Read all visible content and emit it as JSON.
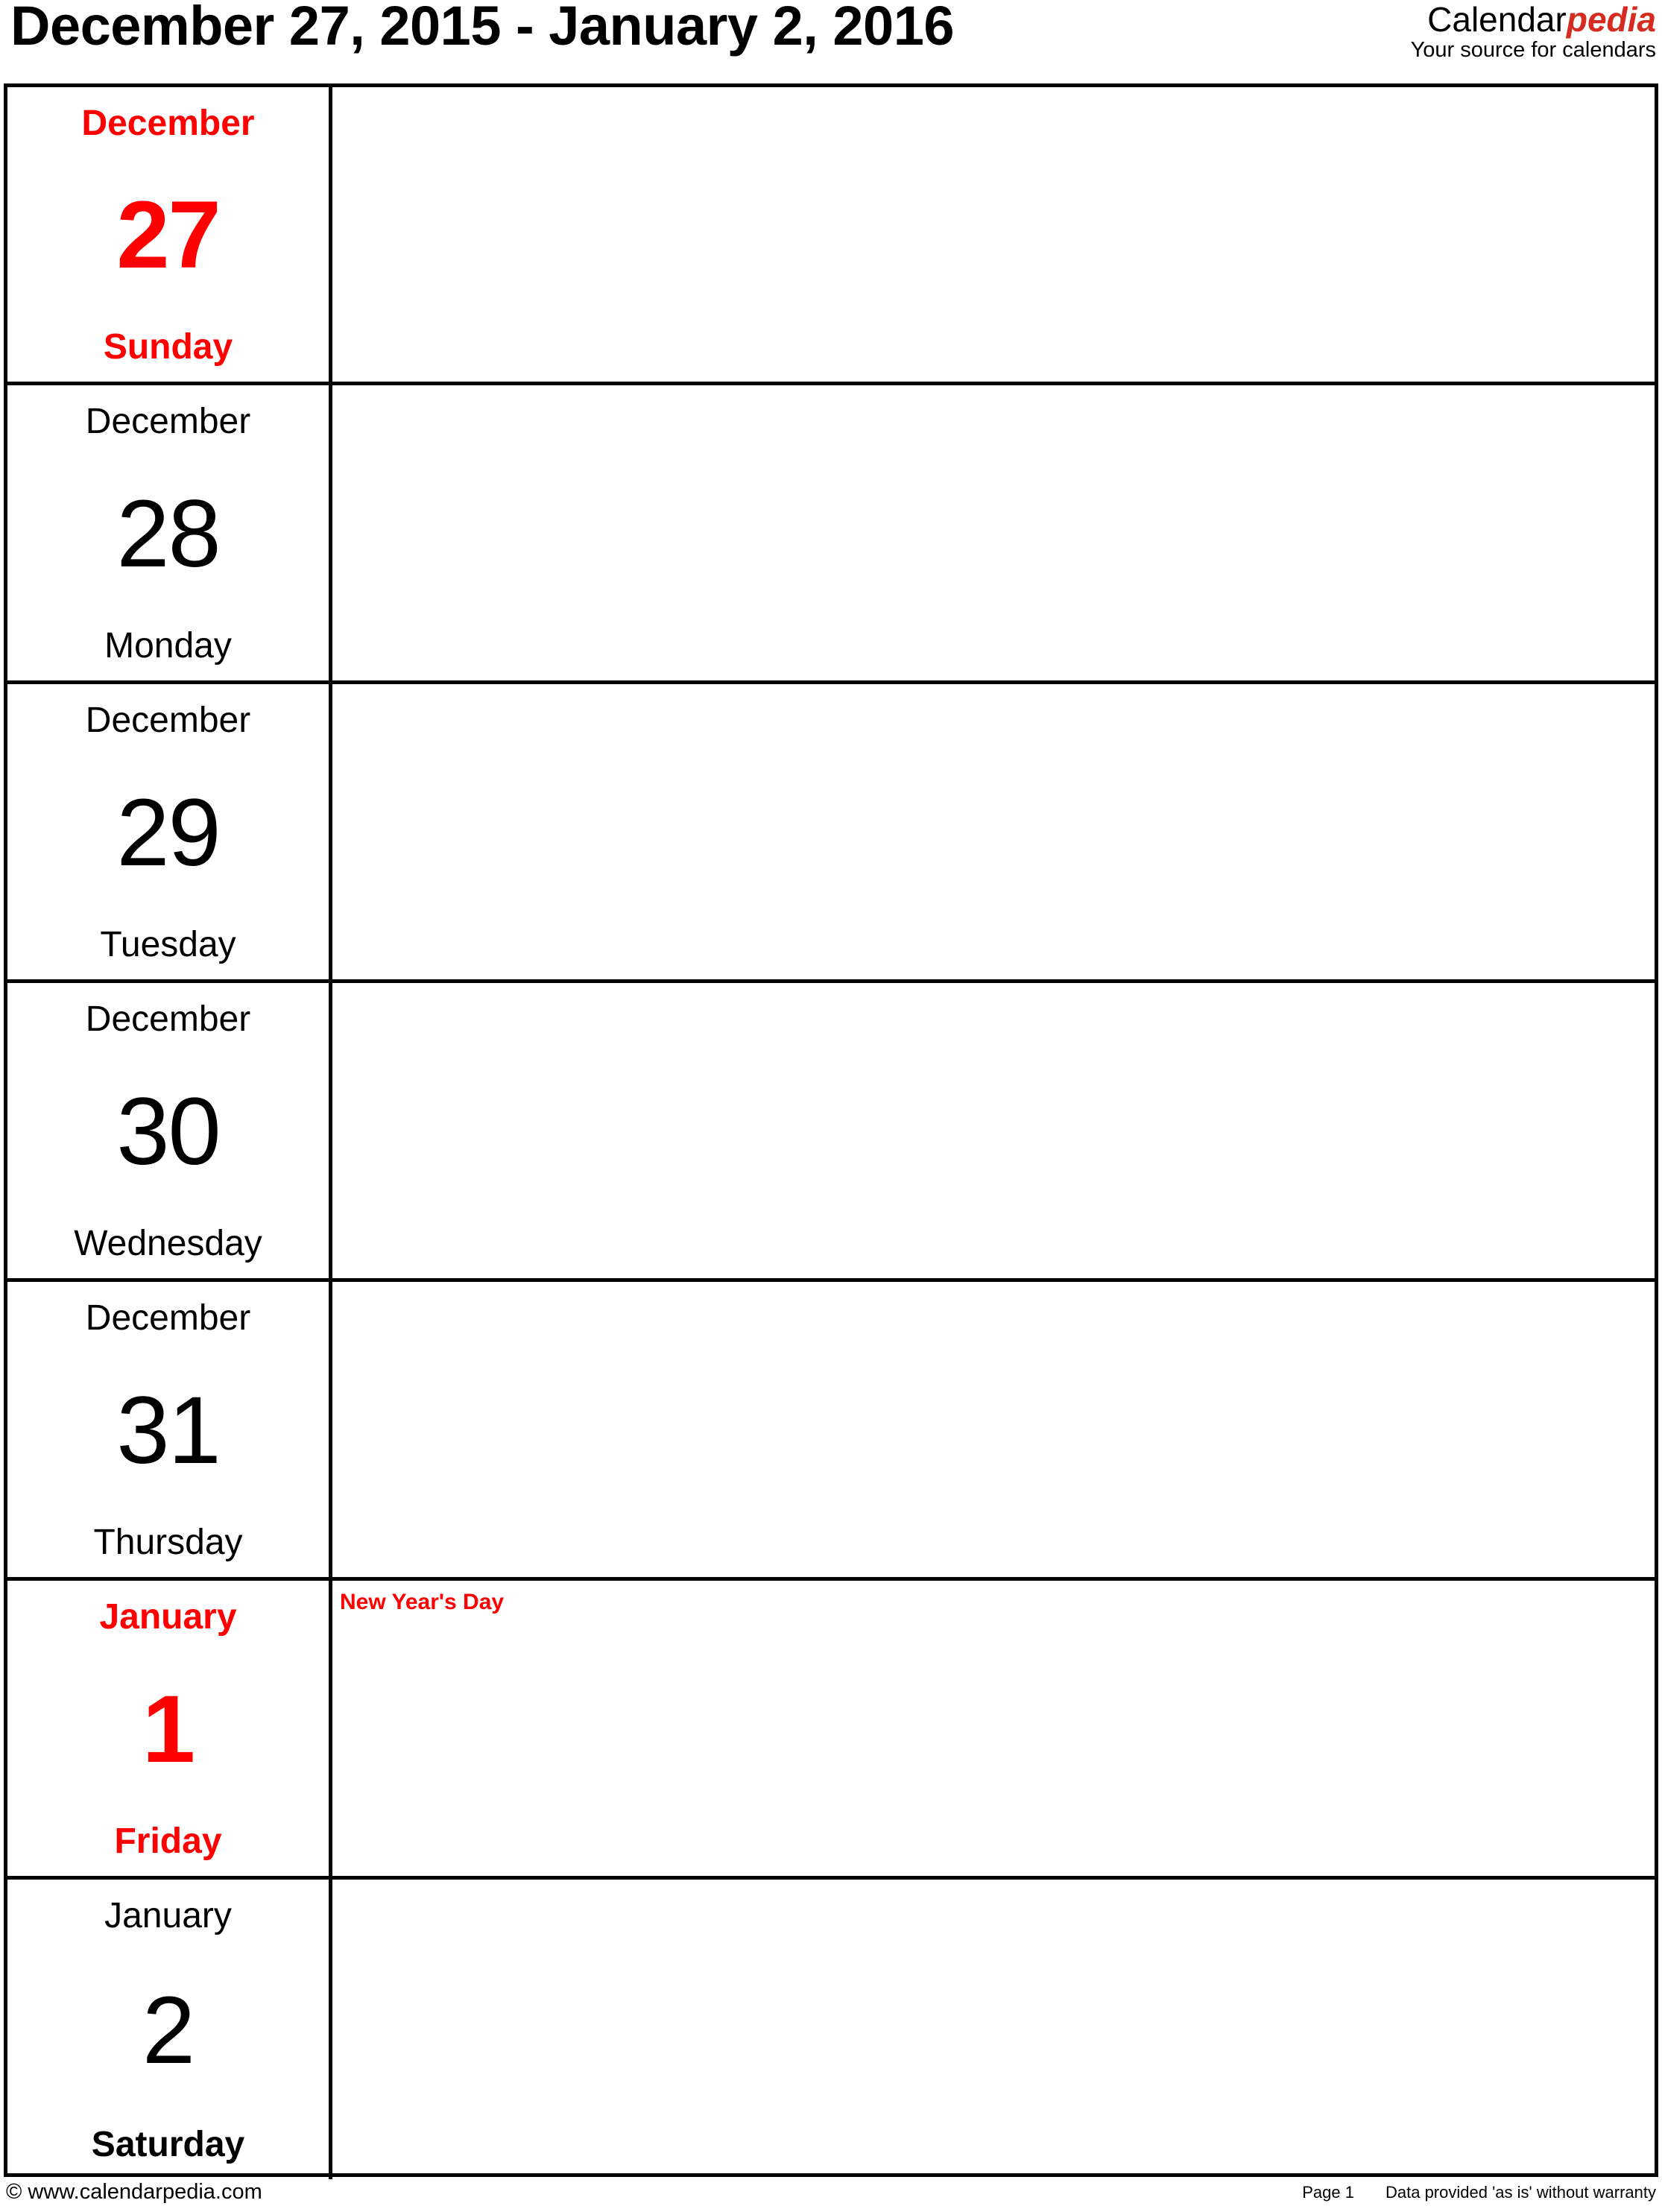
{
  "header": {
    "title": "December 27, 2015 - January 2, 2016",
    "brand": {
      "name_part1": "Calendar",
      "name_part2": "pedia",
      "tagline": "Your source for calendars",
      "accent_color": "#d62b20"
    }
  },
  "colors": {
    "holiday_red": "#ff0000",
    "text_black": "#000000",
    "grid_line": "#000000",
    "background": "#ffffff"
  },
  "calendar": {
    "days": [
      {
        "month": "December",
        "number": "27",
        "weekday": "Sunday",
        "note": "",
        "style": "red"
      },
      {
        "month": "December",
        "number": "28",
        "weekday": "Monday",
        "note": "",
        "style": "normal"
      },
      {
        "month": "December",
        "number": "29",
        "weekday": "Tuesday",
        "note": "",
        "style": "normal"
      },
      {
        "month": "December",
        "number": "30",
        "weekday": "Wednesday",
        "note": "",
        "style": "normal"
      },
      {
        "month": "December",
        "number": "31",
        "weekday": "Thursday",
        "note": "",
        "style": "normal"
      },
      {
        "month": "January",
        "number": "1",
        "weekday": "Friday",
        "note": "New Year's Day",
        "style": "red"
      },
      {
        "month": "January",
        "number": "2",
        "weekday": "Saturday",
        "note": "",
        "style": "bold-weekday"
      }
    ]
  },
  "footer": {
    "copyright": "© www.calendarpedia.com",
    "page": "Page 1",
    "disclaimer": "Data provided 'as is' without warranty"
  }
}
